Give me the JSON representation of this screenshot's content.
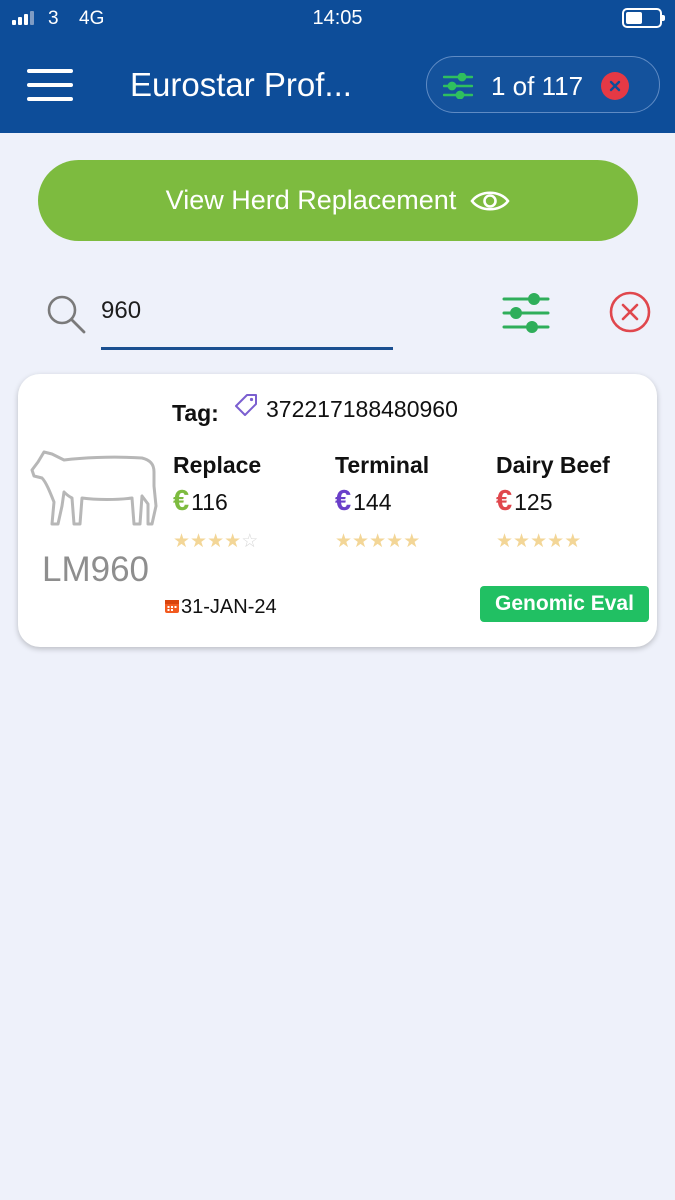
{
  "status_bar": {
    "carrier": "3",
    "network": "4G",
    "time": "14:05"
  },
  "app_bar": {
    "title": "Eurostar Prof...",
    "counter": "1 of 117"
  },
  "herd_button": {
    "label": "View Herd Replacement"
  },
  "search": {
    "value": "960",
    "placeholder": ""
  },
  "result_card": {
    "tag_label": "Tag:",
    "tag_number": "372217188480960",
    "animal_id": "LM960",
    "date": "31-JAN-24",
    "badge": "Genomic Eval",
    "metrics": [
      {
        "label": "Replace",
        "currency": "€",
        "value": "116",
        "stars_filled": 4,
        "stars_total": 5,
        "color": "#7dbb3f"
      },
      {
        "label": "Terminal",
        "currency": "€",
        "value": "144",
        "stars_filled": 5,
        "stars_total": 5,
        "color": "#6a3fc9"
      },
      {
        "label": "Dairy Beef",
        "currency": "€",
        "value": "125",
        "stars_filled": 5,
        "stars_total": 5,
        "color": "#e0474d"
      }
    ]
  },
  "colors": {
    "header": "#0d4d99",
    "primary_green": "#7dbb3f",
    "background": "#eef1fa",
    "badge_green": "#21c063",
    "danger_red": "#e53945"
  },
  "icons": {
    "menu": "hamburger-icon",
    "filter": "sliders-icon",
    "close": "close-circle-icon",
    "view": "eye-icon",
    "search": "magnifier-icon",
    "tag": "tag-icon",
    "animal": "cow-outline-icon",
    "date": "calendar-icon"
  }
}
